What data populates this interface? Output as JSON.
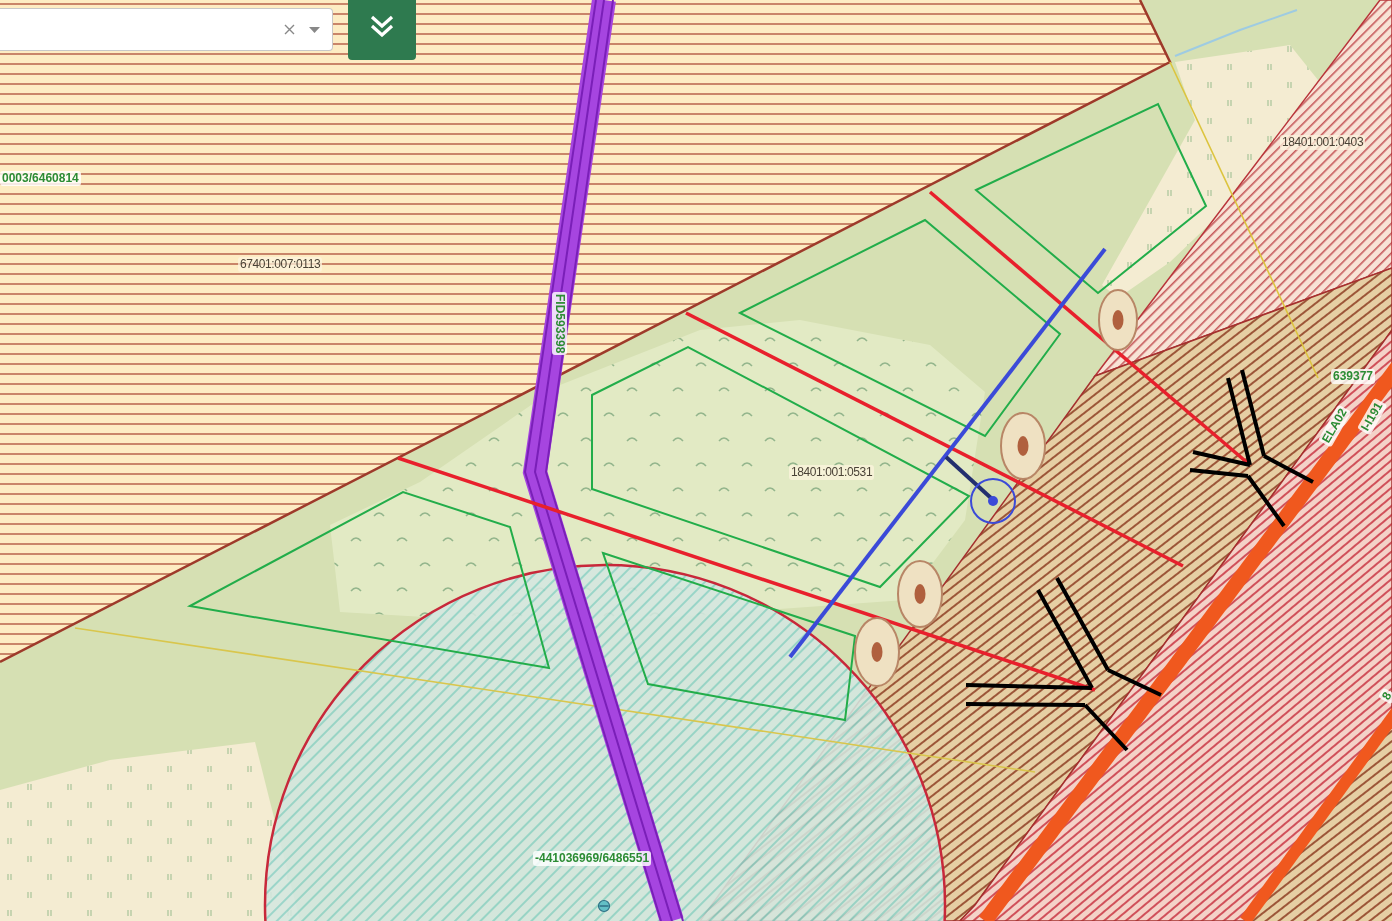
{
  "map": {
    "labels": [
      {
        "kind": "tag",
        "text": "0003/6460814"
      },
      {
        "kind": "parcel",
        "text": "67401:007:0113"
      },
      {
        "kind": "tag",
        "text": "FID593398"
      },
      {
        "kind": "parcel",
        "text": "18401:001:0531"
      },
      {
        "kind": "parcel",
        "text": "18401:001:0403"
      },
      {
        "kind": "tag",
        "text": "639377"
      },
      {
        "kind": "tag",
        "text": "ELA02"
      },
      {
        "kind": "tag",
        "text": "I-I191"
      },
      {
        "kind": "tag",
        "text": "8"
      },
      {
        "kind": "tag",
        "text": "-441036969/6486551"
      }
    ]
  }
}
